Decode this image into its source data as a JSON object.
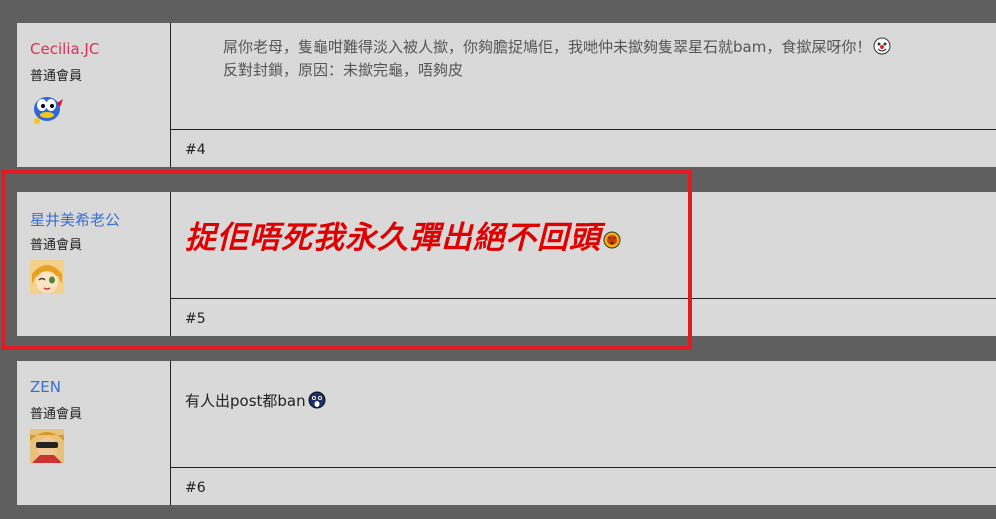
{
  "posts": [
    {
      "username": "Cecilia.JC",
      "username_color": "#d9305d",
      "rank": "普通會員",
      "avatar": "blue-bird-avatar",
      "line1": "屌你老母，隻龜咁難得淡入被人撳，你夠膽捉鳩佢，我哋仲未撳夠隻翠星石就bam，食撳屎呀你！",
      "line2": "反對封鎖，原因：未撳完龜，唔夠皮",
      "floor": "#4"
    },
    {
      "username": "星井美希老公",
      "username_color": "#3c6fd0",
      "rank": "普通會員",
      "avatar": "anime-girl-avatar",
      "text": "捉佢唔死我永久彈出絕不回頭",
      "floor": "#5"
    },
    {
      "username": "ZEN",
      "username_color": "#3c6fd0",
      "rank": "普通會員",
      "avatar": "sunglasses-hero-avatar",
      "text": "有人出post都ban",
      "floor": "#6"
    }
  ],
  "highlight_color": "#e11b22"
}
